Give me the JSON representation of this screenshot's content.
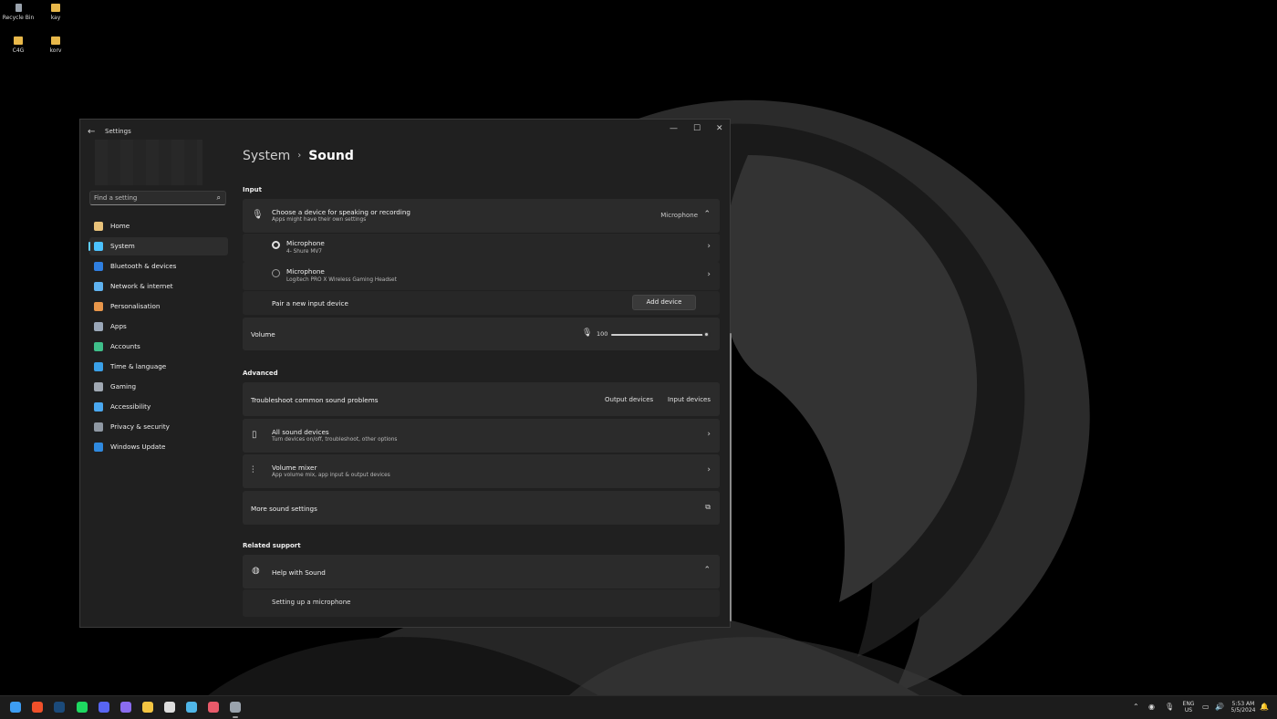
{
  "desktop": {
    "icons": [
      {
        "label": "Recycle Bin",
        "icon": "recycle-bin-icon"
      },
      {
        "label": "kay",
        "icon": "folder-icon"
      },
      {
        "label": "C4G",
        "icon": "folder-icon"
      },
      {
        "label": "korv",
        "icon": "folder-icon"
      }
    ]
  },
  "window": {
    "title": "Settings",
    "controls": {
      "minimize": "—",
      "maximize": "☐",
      "close": "✕"
    }
  },
  "sidebar": {
    "search_placeholder": "Find a setting",
    "items": [
      {
        "label": "Home",
        "icon": "home-icon",
        "color": "#e8c27a"
      },
      {
        "label": "System",
        "icon": "system-icon",
        "color": "#4cc2ff",
        "active": true
      },
      {
        "label": "Bluetooth & devices",
        "icon": "bluetooth-icon",
        "color": "#2f7fe0"
      },
      {
        "label": "Network & internet",
        "icon": "wifi-icon",
        "color": "#5fb2f0"
      },
      {
        "label": "Personalisation",
        "icon": "brush-icon",
        "color": "#e8964a"
      },
      {
        "label": "Apps",
        "icon": "apps-icon",
        "color": "#9aa7b8"
      },
      {
        "label": "Accounts",
        "icon": "accounts-icon",
        "color": "#3fbf8a"
      },
      {
        "label": "Time & language",
        "icon": "globe-clock-icon",
        "color": "#3aa0e8"
      },
      {
        "label": "Gaming",
        "icon": "gamepad-icon",
        "color": "#a0a8b2"
      },
      {
        "label": "Accessibility",
        "icon": "accessibility-icon",
        "color": "#4aa8f0"
      },
      {
        "label": "Privacy & security",
        "icon": "shield-icon",
        "color": "#8f98a3"
      },
      {
        "label": "Windows Update",
        "icon": "update-icon",
        "color": "#2f8ae0"
      }
    ]
  },
  "breadcrumb": {
    "parent": "System",
    "separator": "›",
    "current": "Sound"
  },
  "input_section": {
    "title": "Input",
    "choose": {
      "title": "Choose a device for speaking or recording",
      "subtitle": "Apps might have their own settings",
      "value": "Microphone"
    },
    "devices": [
      {
        "name": "Microphone",
        "detail": "4- Shure MV7",
        "selected": true
      },
      {
        "name": "Microphone",
        "detail": "Logitech PRO X Wireless Gaming Headset",
        "selected": false
      }
    ],
    "pair": {
      "label": "Pair a new input device",
      "button": "Add device"
    },
    "volume": {
      "label": "Volume",
      "value": "100",
      "level": 100
    }
  },
  "advanced_section": {
    "title": "Advanced",
    "troubleshoot": {
      "label": "Troubleshoot common sound problems",
      "output": "Output devices",
      "input": "Input devices"
    },
    "all_devices": {
      "title": "All sound devices",
      "subtitle": "Turn devices on/off, troubleshoot, other options"
    },
    "mixer": {
      "title": "Volume mixer",
      "subtitle": "App volume mix, app input & output devices"
    },
    "more": {
      "label": "More sound settings"
    }
  },
  "related_section": {
    "title": "Related support",
    "help": {
      "title": "Help with Sound",
      "link": "Setting up a microphone"
    }
  },
  "taskbar": {
    "apps": [
      {
        "name": "start-icon",
        "color": "#3d9df3",
        "running": false
      },
      {
        "name": "brave-icon",
        "color": "#f0502a",
        "running": false
      },
      {
        "name": "steam-icon",
        "color": "#1b4a7a",
        "running": false
      },
      {
        "name": "spotify-icon",
        "color": "#1ed760",
        "running": false
      },
      {
        "name": "discord-icon",
        "color": "#5865f2",
        "running": false
      },
      {
        "name": "proton-mail-icon",
        "color": "#8a6cf0",
        "running": false
      },
      {
        "name": "obs-icon",
        "color": "#dddddd",
        "running": false
      },
      {
        "name": "file-explorer-icon",
        "color": "#f4c542",
        "running": false
      },
      {
        "name": "notepad-icon",
        "color": "#4fb6e8",
        "running": false
      },
      {
        "name": "snipping-tool-icon",
        "color": "#e85a6a",
        "running": false
      },
      {
        "name": "settings-icon",
        "color": "#9aa3ad",
        "running": true
      }
    ],
    "tray": {
      "lang_top": "ENG",
      "lang_bottom": "US",
      "time": "5:53 AM",
      "date": "5/5/2024"
    }
  }
}
